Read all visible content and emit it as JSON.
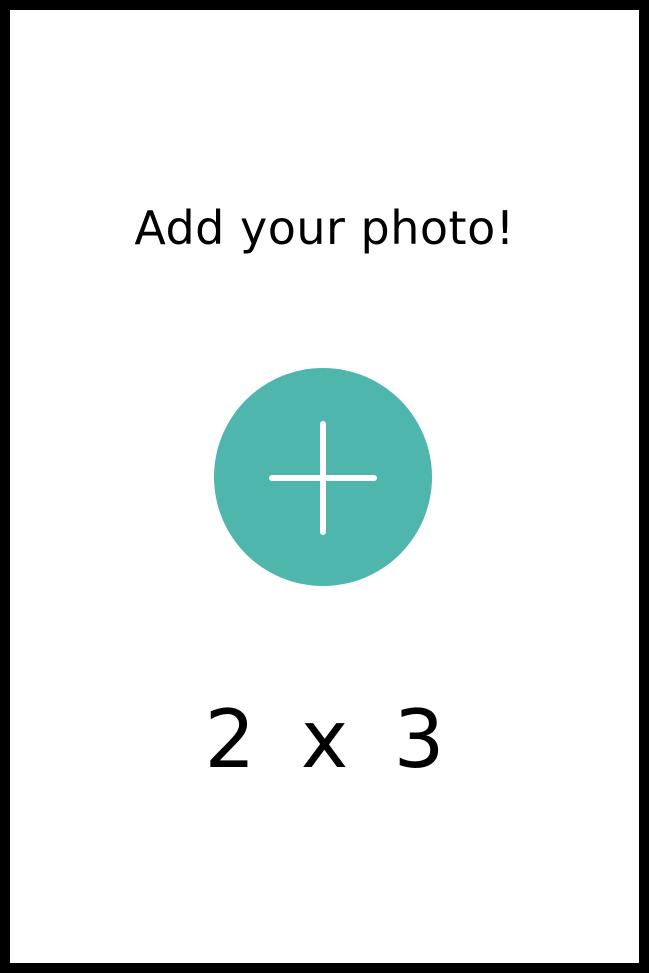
{
  "page": {
    "title": "Add your photo!",
    "size_label": "2 x 3"
  },
  "add_button": {
    "icon": "plus-icon",
    "color": "#4fb6ae"
  },
  "colors": {
    "frame_border": "#000000",
    "background": "#ffffff",
    "text": "#000000"
  }
}
